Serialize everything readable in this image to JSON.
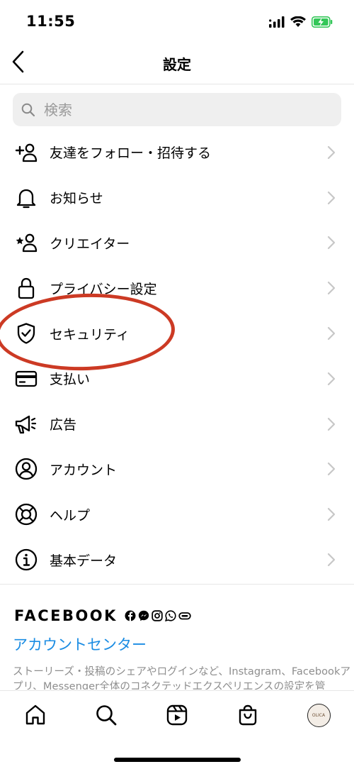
{
  "status_bar": {
    "time": "11:55"
  },
  "header": {
    "title": "設定"
  },
  "search": {
    "placeholder": "検索"
  },
  "menu": [
    {
      "label": "友達をフォロー・招待する",
      "icon": "add-person-icon"
    },
    {
      "label": "お知らせ",
      "icon": "bell-icon"
    },
    {
      "label": "クリエイター",
      "icon": "creator-icon"
    },
    {
      "label": "プライバシー設定",
      "icon": "lock-icon"
    },
    {
      "label": "セキュリティ",
      "icon": "shield-check-icon"
    },
    {
      "label": "支払い",
      "icon": "card-icon"
    },
    {
      "label": "広告",
      "icon": "megaphone-icon"
    },
    {
      "label": "アカウント",
      "icon": "account-circle-icon"
    },
    {
      "label": "ヘルプ",
      "icon": "lifebuoy-icon"
    },
    {
      "label": "基本データ",
      "icon": "info-icon"
    }
  ],
  "facebook": {
    "wordmark": "FACEBOOK",
    "link": "アカウントセンター",
    "description": "ストーリーズ・投稿のシェアやログインなど、Instagram、Facebookアプリ、Messenger全体のコネクテッドエクスペリエンスの設定を管"
  },
  "tab_bar": {
    "items": [
      "home-icon",
      "search-icon",
      "reels-icon",
      "shop-icon",
      "profile-avatar"
    ],
    "avatar_text": "OLICA"
  },
  "colors": {
    "link": "#1a8ce3",
    "annotation": "#cc3a24",
    "battery": "#34c759"
  }
}
